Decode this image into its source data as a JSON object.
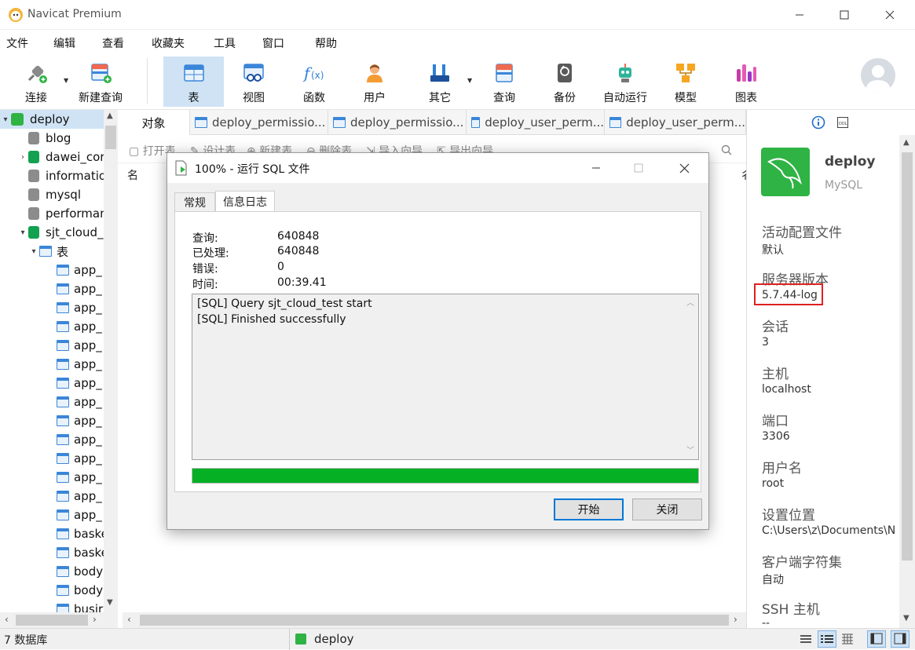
{
  "window": {
    "title": "Navicat Premium",
    "controls": [
      "minimize",
      "maximize",
      "close"
    ]
  },
  "menu": [
    "文件",
    "编辑",
    "查看",
    "收藏夹",
    "工具",
    "窗口",
    "帮助"
  ],
  "toolbar": {
    "items": [
      {
        "label": "连接",
        "icon": "plug-icon"
      },
      {
        "label": "新建查询",
        "icon": "new-query-icon"
      },
      {
        "label": "表",
        "icon": "table-icon"
      },
      {
        "label": "视图",
        "icon": "view-icon"
      },
      {
        "label": "函数",
        "icon": "function-icon",
        "glyph": "f(x)"
      },
      {
        "label": "用户",
        "icon": "user-icon"
      },
      {
        "label": "其它",
        "icon": "tools-icon"
      },
      {
        "label": "查询",
        "icon": "query-icon"
      },
      {
        "label": "备份",
        "icon": "backup-icon"
      },
      {
        "label": "自动运行",
        "icon": "robot-icon"
      },
      {
        "label": "模型",
        "icon": "model-icon"
      },
      {
        "label": "图表",
        "icon": "chart-icon"
      }
    ],
    "active": "表"
  },
  "nav": {
    "items": [
      {
        "label": "deploy",
        "level": 0,
        "type": "connection",
        "caret": "▾",
        "selected": true
      },
      {
        "label": "blog",
        "level": 1,
        "type": "db-gray"
      },
      {
        "label": "dawei_cor",
        "level": 1,
        "type": "db-green",
        "caret": "›"
      },
      {
        "label": "informatio",
        "level": 1,
        "type": "db-gray"
      },
      {
        "label": "mysql",
        "level": 1,
        "type": "db-gray"
      },
      {
        "label": "performan",
        "level": 1,
        "type": "db-gray"
      },
      {
        "label": "sjt_cloud_",
        "level": 1,
        "type": "db-green",
        "caret": "▾"
      },
      {
        "label": "表",
        "level": 2,
        "type": "tables",
        "caret": "▾"
      },
      {
        "label": "app_",
        "level": 3,
        "type": "table"
      },
      {
        "label": "app_",
        "level": 3,
        "type": "table"
      },
      {
        "label": "app_",
        "level": 3,
        "type": "table"
      },
      {
        "label": "app_",
        "level": 3,
        "type": "table"
      },
      {
        "label": "app_",
        "level": 3,
        "type": "table"
      },
      {
        "label": "app_",
        "level": 3,
        "type": "table"
      },
      {
        "label": "app_",
        "level": 3,
        "type": "table"
      },
      {
        "label": "app_",
        "level": 3,
        "type": "table"
      },
      {
        "label": "app_",
        "level": 3,
        "type": "table"
      },
      {
        "label": "app_",
        "level": 3,
        "type": "table"
      },
      {
        "label": "app_",
        "level": 3,
        "type": "table"
      },
      {
        "label": "app_",
        "level": 3,
        "type": "table"
      },
      {
        "label": "app_",
        "level": 3,
        "type": "table"
      },
      {
        "label": "app_",
        "level": 3,
        "type": "table"
      },
      {
        "label": "baske",
        "level": 3,
        "type": "table"
      },
      {
        "label": "baske",
        "level": 3,
        "type": "table"
      },
      {
        "label": "body",
        "level": 3,
        "type": "table"
      },
      {
        "label": "body",
        "level": 3,
        "type": "table"
      },
      {
        "label": "busir",
        "level": 3,
        "type": "table"
      }
    ]
  },
  "tabs": [
    "对象",
    "deploy_permissio...",
    "deploy_permissio...",
    "deploy_user_perm...",
    "deploy_user_perm..."
  ],
  "object_toolbar": [
    "打开表",
    "设计表",
    "新建表",
    "删除表",
    "导入向导",
    "导出向导"
  ],
  "content": {
    "column_header": "名"
  },
  "info": {
    "name": "deploy",
    "type": "MySQL",
    "fields": [
      {
        "label": "活动配置文件",
        "value": "默认"
      },
      {
        "label": "服务器版本",
        "value": "5.7.44-log",
        "highlight": true
      },
      {
        "label": "会话",
        "value": "3"
      },
      {
        "label": "主机",
        "value": "localhost"
      },
      {
        "label": "端口",
        "value": "3306"
      },
      {
        "label": "用户名",
        "value": "root"
      },
      {
        "label": "设置位置",
        "value": "C:\\Users\\z\\Documents\\N"
      },
      {
        "label": "客户端字符集",
        "value": "自动"
      },
      {
        "label": "SSH 主机",
        "value": "--"
      }
    ]
  },
  "status": {
    "db_count": "7 数据库",
    "connection": "deploy"
  },
  "dialog": {
    "title": "100% - 运行 SQL 文件",
    "tabs": [
      "常规",
      "信息日志"
    ],
    "active_tab": "信息日志",
    "stats": [
      {
        "label": "查询:",
        "value": "640848"
      },
      {
        "label": "已处理:",
        "value": "640848"
      },
      {
        "label": "错误:",
        "value": "0"
      },
      {
        "label": "时间:",
        "value": "00:39.41"
      }
    ],
    "log": [
      "[SQL] Query sjt_cloud_test start",
      "[SQL] Finished successfully"
    ],
    "progress": 1.0,
    "buttons": {
      "start": "开始",
      "close": "关闭"
    }
  },
  "colors": {
    "accent": "#0078d7",
    "selection": "#cfe3f5",
    "progress": "#06b025",
    "highlight_box": "#e02020",
    "db_green": "#12a150"
  }
}
